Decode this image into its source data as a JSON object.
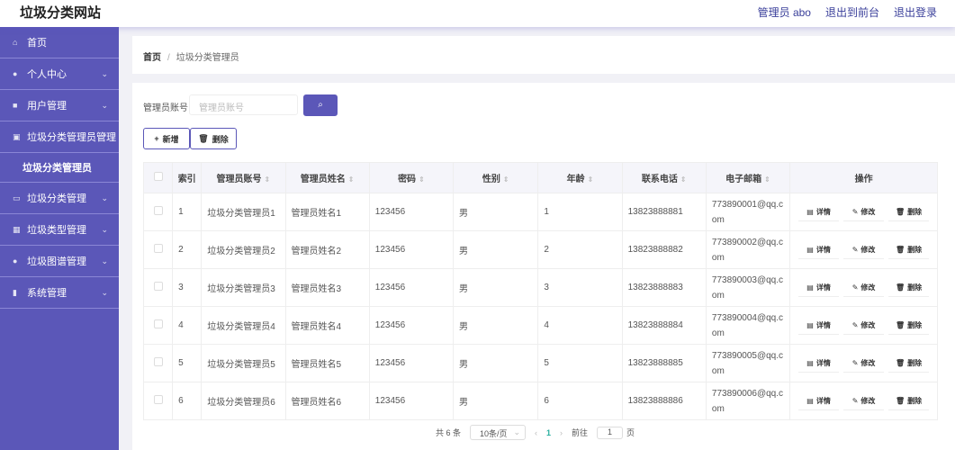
{
  "header": {
    "title": "垃圾分类网站",
    "links": [
      "管理员 abo",
      "退出到前台",
      "退出登录"
    ]
  },
  "sidebar": {
    "items": [
      {
        "label": "首页",
        "icon": "home-icon",
        "glyph": "⌂",
        "chevron": ""
      },
      {
        "label": "个人中心",
        "icon": "user-icon",
        "glyph": "●",
        "chevron": "⌄"
      },
      {
        "label": "用户管理",
        "icon": "monitor-icon",
        "glyph": "■",
        "chevron": "⌄"
      },
      {
        "label": "垃圾分类管理员管理",
        "icon": "chart-icon",
        "glyph": "▣",
        "chevron": "⌃"
      },
      {
        "label": "垃圾分类管理",
        "icon": "chat-icon",
        "glyph": "▭",
        "chevron": "⌄"
      },
      {
        "label": "垃圾类型管理",
        "icon": "grid-icon",
        "glyph": "▦",
        "chevron": "⌄"
      },
      {
        "label": "垃圾图谱管理",
        "icon": "user-icon",
        "glyph": "●",
        "chevron": "⌄"
      },
      {
        "label": "系统管理",
        "icon": "bar-chart-icon",
        "glyph": "▮",
        "chevron": "⌄"
      }
    ],
    "submenu": "垃圾分类管理员"
  },
  "breadcrumb": {
    "home": "首页",
    "sep": "/",
    "current": "垃圾分类管理员"
  },
  "search": {
    "label": "管理员账号",
    "placeholder": "管理员账号",
    "button": "⌕"
  },
  "actions": {
    "add": "新增",
    "delete": "删除"
  },
  "table": {
    "headers": [
      "索引",
      "管理员账号",
      "管理员姓名",
      "密码",
      "性别",
      "年龄",
      "联系电话",
      "电子邮箱",
      "操作"
    ],
    "rows": [
      [
        "1",
        "垃圾分类管理员1",
        "管理员姓名1",
        "123456",
        "男",
        "1",
        "13823888881",
        "773890001@qq.com"
      ],
      [
        "2",
        "垃圾分类管理员2",
        "管理员姓名2",
        "123456",
        "男",
        "2",
        "13823888882",
        "773890002@qq.com"
      ],
      [
        "3",
        "垃圾分类管理员3",
        "管理员姓名3",
        "123456",
        "男",
        "3",
        "13823888883",
        "773890003@qq.com"
      ],
      [
        "4",
        "垃圾分类管理员4",
        "管理员姓名4",
        "123456",
        "男",
        "4",
        "13823888884",
        "773890004@qq.com"
      ],
      [
        "5",
        "垃圾分类管理员5",
        "管理员姓名5",
        "123456",
        "男",
        "5",
        "13823888885",
        "773890005@qq.com"
      ],
      [
        "6",
        "垃圾分类管理员6",
        "管理员姓名6",
        "123456",
        "男",
        "6",
        "13823888886",
        "773890006@qq.com"
      ]
    ],
    "ops": [
      "详情",
      "修改",
      "删除"
    ]
  },
  "pagination": {
    "total": "共 6 条",
    "page_size": "10条/页",
    "current": "1",
    "goto": "前往",
    "goto_value": "1",
    "page_unit": "页"
  },
  "colors": {
    "primary": "#5b57b8"
  }
}
